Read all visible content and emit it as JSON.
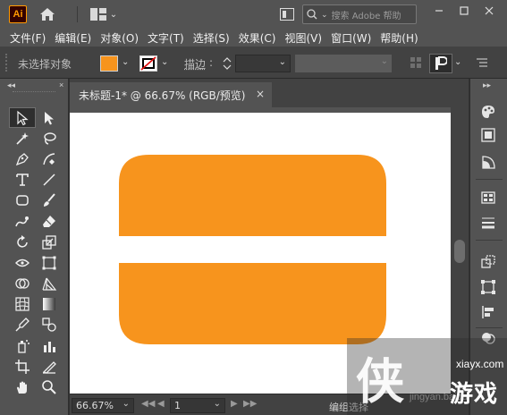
{
  "app": {
    "logo_text": "Ai"
  },
  "titlebar": {
    "search_label": "搜索 Adobe 帮助",
    "window_buttons": [
      "minimize-icon",
      "maximize-icon",
      "close-icon"
    ]
  },
  "menubar": {
    "items": [
      {
        "label": "文件(F)"
      },
      {
        "label": "编辑(E)"
      },
      {
        "label": "对象(O)"
      },
      {
        "label": "文字(T)"
      },
      {
        "label": "选择(S)"
      },
      {
        "label": "效果(C)"
      },
      {
        "label": "视图(V)"
      },
      {
        "label": "窗口(W)"
      },
      {
        "label": "帮助(H)"
      }
    ]
  },
  "controlbar": {
    "no_selection": "未选择对象",
    "fill_color": "#f7941d",
    "stroke_label": "描边",
    "stroke_value": "",
    "separator": ":"
  },
  "document": {
    "tab_title": "未标题-1* @ 66.67% (RGB/预览)",
    "close_glyph": "×",
    "shape_color": "#f7941d",
    "artboard_color": "#ffffff"
  },
  "statusbar": {
    "zoom": "66.67%",
    "artboard_number": "1",
    "status_text": "编组选择"
  },
  "tools": [
    "selection-tool-icon",
    "direct-selection-tool-icon",
    "magic-wand-tool-icon",
    "lasso-tool-icon",
    "pen-tool-icon",
    "curvature-tool-icon",
    "type-tool-icon",
    "line-segment-tool-icon",
    "rectangle-tool-icon",
    "paintbrush-tool-icon",
    "shaper-tool-icon",
    "eraser-tool-icon",
    "rotate-tool-icon",
    "scale-tool-icon",
    "width-tool-icon",
    "free-transform-tool-icon",
    "shape-builder-tool-icon",
    "perspective-grid-tool-icon",
    "mesh-tool-icon",
    "gradient-tool-icon",
    "eyedropper-tool-icon",
    "blend-tool-icon",
    "symbol-sprayer-tool-icon",
    "column-graph-tool-icon",
    "artboard-tool-icon",
    "slice-tool-icon",
    "hand-tool-icon",
    "zoom-tool-icon"
  ],
  "right_panel_icons": [
    "color-panel-icon",
    "swatches-panel-icon",
    "color-guide-icon",
    "libraries-panel-icon",
    "stroke-panel-icon",
    "transform-panel-icon",
    "align-panel-icon",
    "distribute-panel-icon",
    "pathfinder-panel-icon"
  ],
  "watermark": {
    "glyph": "侠",
    "site": "xiayx.com",
    "name": "游戏",
    "underlay": "jingyan.baidu"
  }
}
